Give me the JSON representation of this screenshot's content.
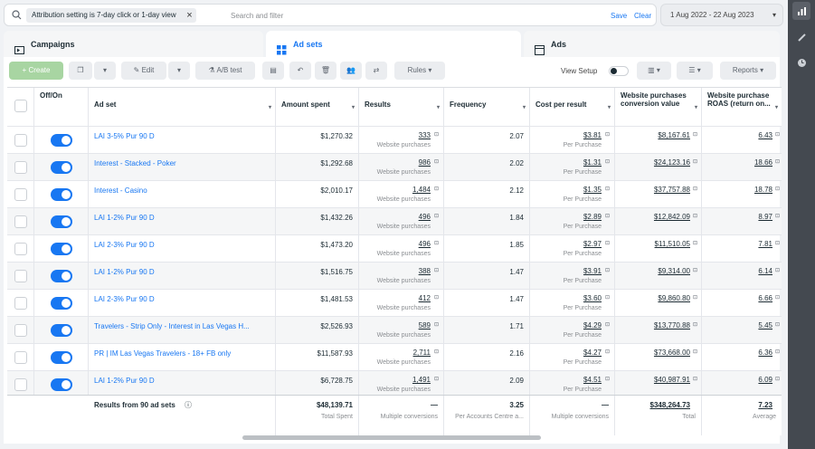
{
  "filter": {
    "chip": "Attribution setting is 7-day click or 1-day view",
    "placeholder": "Search and filter",
    "save": "Save",
    "clear": "Clear",
    "date": "1 Aug 2022 - 22 Aug 2023"
  },
  "tabs": [
    "Campaigns",
    "Ad sets",
    "Ads"
  ],
  "toolbar": {
    "create": "+ Create",
    "edit": "Edit",
    "ab": "A/B test",
    "rules": "Rules",
    "view_setup": "View Setup",
    "reports": "Reports"
  },
  "columns": [
    "Off/On",
    "Ad set",
    "Amount spent",
    "Results",
    "Frequency",
    "Cost per result",
    "Website purchases conversion value",
    "Website purchase ROAS (return on..."
  ],
  "rows": [
    {
      "name": "LAI 3-5% Pur 90 D",
      "spent": "$1,270.32",
      "results": "333",
      "freq": "2.07",
      "cpr": "$3.81",
      "value": "$8,167.61",
      "roas": "6.43"
    },
    {
      "name": "Interest - Stacked - Poker",
      "spent": "$1,292.68",
      "results": "986",
      "freq": "2.02",
      "cpr": "$1.31",
      "value": "$24,123.16",
      "roas": "18.66"
    },
    {
      "name": "Interest - Casino",
      "spent": "$2,010.17",
      "results": "1,484",
      "freq": "2.12",
      "cpr": "$1.35",
      "value": "$37,757.88",
      "roas": "18.78"
    },
    {
      "name": "LAI 1-2% Pur 90 D",
      "spent": "$1,432.26",
      "results": "496",
      "freq": "1.84",
      "cpr": "$2.89",
      "value": "$12,842.09",
      "roas": "8.97"
    },
    {
      "name": "LAI 2-3% Pur 90 D",
      "spent": "$1,473.20",
      "results": "496",
      "freq": "1.85",
      "cpr": "$2.97",
      "value": "$11,510.05",
      "roas": "7.81"
    },
    {
      "name": "LAI 1-2% Pur 90 D",
      "spent": "$1,516.75",
      "results": "388",
      "freq": "1.47",
      "cpr": "$3.91",
      "value": "$9,314.00",
      "roas": "6.14"
    },
    {
      "name": "LAI 2-3% Pur 90 D",
      "spent": "$1,481.53",
      "results": "412",
      "freq": "1.47",
      "cpr": "$3.60",
      "value": "$9,860.80",
      "roas": "6.66"
    },
    {
      "name": "Travelers - Strip Only - Interest in Las Vegas H...",
      "spent": "$2,526.93",
      "results": "589",
      "freq": "1.71",
      "cpr": "$4.29",
      "value": "$13,770.88",
      "roas": "5.45"
    },
    {
      "name": "PR | IM Las Vegas Travelers - 18+ FB only",
      "spent": "$11,587.93",
      "results": "2,711",
      "freq": "2.16",
      "cpr": "$4.27",
      "value": "$73,668.00",
      "roas": "6.36"
    },
    {
      "name": "LAI 1-2% Pur 90 D",
      "spent": "$6,728.75",
      "results": "1,491",
      "freq": "2.09",
      "cpr": "$4.51",
      "value": "$40,987.91",
      "roas": "6.09"
    }
  ],
  "labels": {
    "results_sub": "Website purchases",
    "cpr_sub": "Per Purchase"
  },
  "totals": {
    "label": "Results from 90 ad sets",
    "spent": "$48,139.71",
    "spent_sub": "Total Spent",
    "results": "—",
    "results_sub": "Multiple conversions",
    "freq": "3.25",
    "freq_sub": "Per Accounts Centre a...",
    "cpr": "—",
    "cpr_sub": "Multiple conversions",
    "value": "$348,264.73",
    "value_sub": "Total",
    "roas": "7.23",
    "roas_sub": "Average"
  }
}
